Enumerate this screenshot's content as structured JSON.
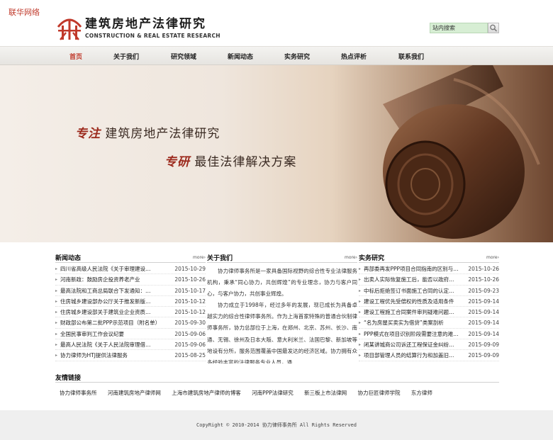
{
  "corner_tag": "联华网络",
  "logo": {
    "cn": "建筑房地产法律研究",
    "en": "CONSTRUCTION & REAL ESTATE RESEARCH",
    "mark_color": "#c0392b"
  },
  "search": {
    "value": "站内搜索",
    "icon": "search-icon"
  },
  "nav": [
    {
      "label": "首页",
      "active": true
    },
    {
      "label": "关于我们",
      "active": false
    },
    {
      "label": "研究领域",
      "active": false
    },
    {
      "label": "新闻动态",
      "active": false
    },
    {
      "label": "实务研究",
      "active": false
    },
    {
      "label": "热点评析",
      "active": false
    },
    {
      "label": "联系我们",
      "active": false
    }
  ],
  "banner": {
    "line1_prefix": "专注",
    "line1_text": "建筑房地产法律研究",
    "line2_prefix": "专研",
    "line2_text": "最佳法律解决方案"
  },
  "news": {
    "title": "新闻动态",
    "more": "more",
    "items": [
      {
        "title": "四川省高级人民法院《关于审理建设…",
        "date": "2015-10-29"
      },
      {
        "title": "河南新政：鼓励房企投资养老产业",
        "date": "2015-10-26"
      },
      {
        "title": "最高法院和工商总局联合下发通知：…",
        "date": "2015-10-17"
      },
      {
        "title": "住房城乡建设部办公厅关于推发新版…",
        "date": "2015-10-12"
      },
      {
        "title": "住房城乡建设部关于建筑业企业资质…",
        "date": "2015-10-12"
      },
      {
        "title": "财政部公布第二批PPP示范项目（附名单）",
        "date": "2015-09-30"
      },
      {
        "title": "全国民事审判工作会议纪要",
        "date": "2015-09-06"
      },
      {
        "title": "最高人民法院《关于人民法院审理借…",
        "date": "2015-09-06"
      },
      {
        "title": "协力律师为HTJ提供法律服务",
        "date": "2015-08-25"
      }
    ]
  },
  "about": {
    "title": "关于我们",
    "more": "more",
    "p1": "协力律师事务所是一家具备国际视野的综合性专业法律服务机构，秉承“同心协力，共创辉煌”的专业理念，协力与客户同心，与客户协力，共创事业辉煌。",
    "p2": "协力成立于1998年，经过多年的发展，现已成长为具备卓越实力的综合性律师事务所。作为上海首家特殊的普通合伙制律师事务所，协力总部位于上海，在郑州、北京、苏州、长沙、南通、无锡、徐州及日本大阪、意大利米兰、法国巴黎、新加坡等地设有分所，服务范围覆盖中国最发达的经济区域。协力拥有众多经验丰富的法律服务专业人员，通"
  },
  "practice": {
    "title": "实务研究",
    "more": "more",
    "items": [
      {
        "title": "再部委再发PPP项目合同指南的区别与…",
        "date": "2015-10-26"
      },
      {
        "title": "出卖人实际恢复施工后，能否以政府…",
        "date": "2015-10-26"
      },
      {
        "title": "中标后拒绝签订书面施工合同的认定…",
        "date": "2015-09-23"
      },
      {
        "title": "建设工程优先受偿权的性质及适用条件",
        "date": "2015-09-14"
      },
      {
        "title": "建设工程施工合同案件审判疑难问题…",
        "date": "2015-09-14"
      },
      {
        "title": "“名为房屋买卖实为借贷”类案剖析",
        "date": "2015-09-14"
      },
      {
        "title": "PPP模式在项目识别阶段需要注意的难…",
        "date": "2015-09-14"
      },
      {
        "title": "闭某讲城商公司诉还工程保证金纠纷…",
        "date": "2015-09-09"
      },
      {
        "title": "项目部管理人员的结算行为和加盖旧…",
        "date": "2015-09-09"
      }
    ]
  },
  "links": {
    "title": "友情链接",
    "items": [
      "协力律师事务所",
      "河南建筑房地产律师网",
      "上海市建筑房地产律师的博客",
      "河南PPP法律研究",
      "新三板上市法律网",
      "协力巨匠律师学院",
      "东方律师"
    ]
  },
  "footer": {
    "copyright": "CopyRight © 2010-2014 协力律师事务所 All Rights Reserved"
  }
}
